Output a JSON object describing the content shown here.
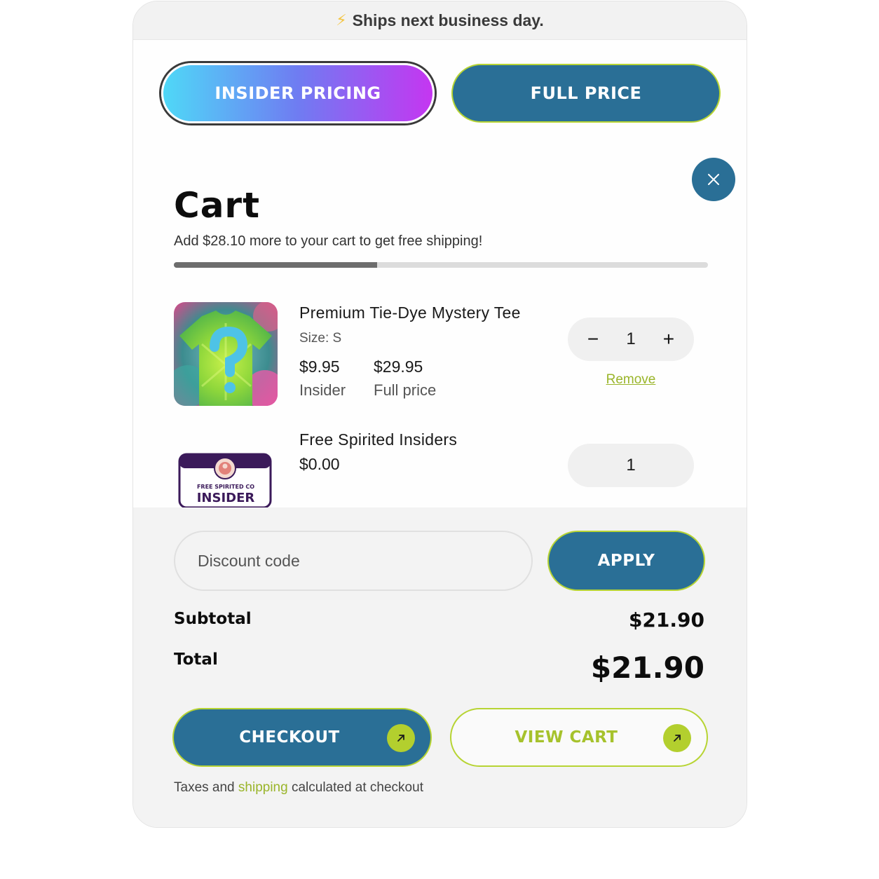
{
  "banner": {
    "icon": "lightning-bolt-icon",
    "text": "Ships next business day."
  },
  "pricing_toggle": {
    "insider_label": "INSIDER PRICING",
    "full_label": "FULL PRICE"
  },
  "cart": {
    "title": "Cart",
    "free_shipping_message": "Add $28.10 more to your cart to get free shipping!",
    "free_shipping_progress": 0.38,
    "items": [
      {
        "name": "Premium Tie-Dye Mystery Tee",
        "variant": "Size: S",
        "insider_price": "$9.95",
        "insider_label": "Insider",
        "full_price": "$29.95",
        "full_price_label": "Full price",
        "quantity": "1",
        "remove_label": "Remove",
        "image": "tie-dye-tee-image"
      },
      {
        "name": "Free Spirited Insiders",
        "price": "$0.00",
        "quantity": "1",
        "image": "insider-badge-image",
        "badge_top": "FREE SPIRITED CO",
        "badge_main": "INSIDER"
      }
    ]
  },
  "discount": {
    "placeholder": "Discount code",
    "apply_label": "APPLY"
  },
  "summary": {
    "subtotal_label": "Subtotal",
    "subtotal_value": "$21.90",
    "total_label": "Total",
    "total_value": "$21.90"
  },
  "actions": {
    "checkout_label": "CHECKOUT",
    "view_cart_label": "VIEW CART"
  },
  "taxes_note": {
    "before": "Taxes and ",
    "link": "shipping",
    "after": " calculated at checkout"
  },
  "colors": {
    "brand_blue": "#2a6f96",
    "accent_lime": "#b7d433",
    "gradient_start": "#4fd8f7",
    "gradient_end": "#c536f1"
  }
}
